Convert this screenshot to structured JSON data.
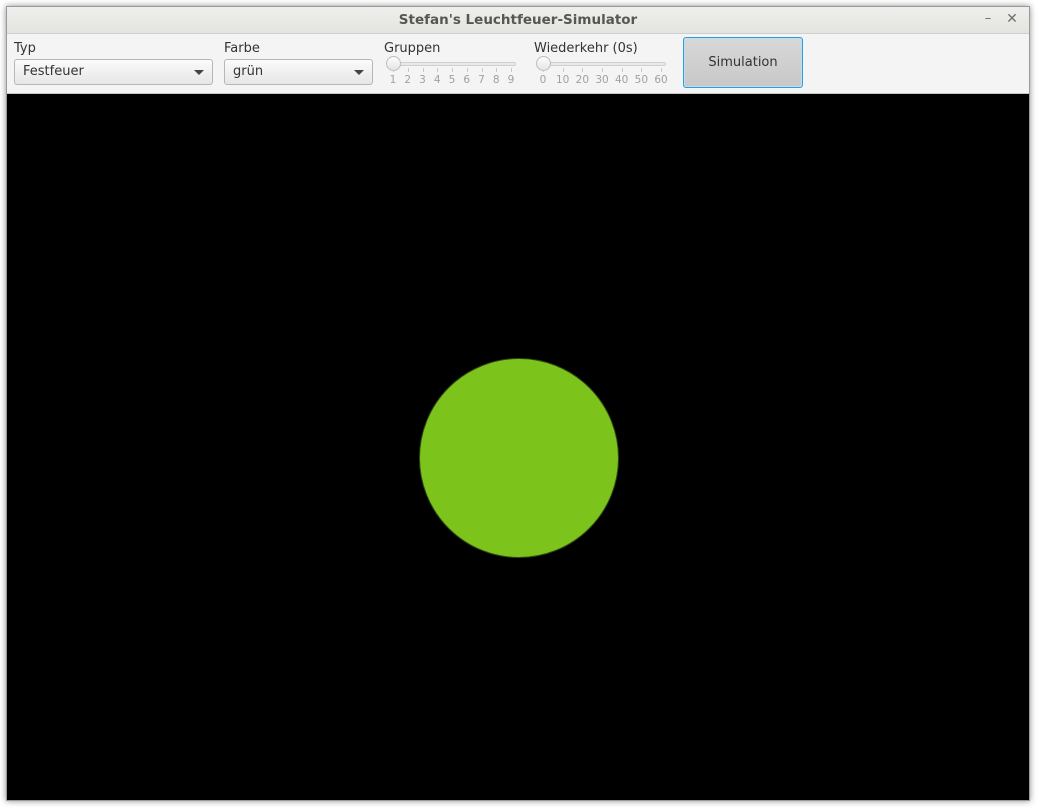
{
  "window": {
    "title": "Stefan's Leuchtfeuer-Simulator",
    "minimize_glyph": "–",
    "close_glyph": "✕"
  },
  "controls": {
    "typ": {
      "label": "Typ",
      "value": "Festfeuer"
    },
    "farbe": {
      "label": "Farbe",
      "value": "grün"
    },
    "gruppen": {
      "label": "Gruppen",
      "ticks": [
        "1",
        "2",
        "3",
        "4",
        "5",
        "6",
        "7",
        "8",
        "9"
      ],
      "value": 1
    },
    "wiederkehr": {
      "label": "Wiederkehr (0s)",
      "ticks": [
        "0",
        "10",
        "20",
        "30",
        "40",
        "50",
        "60"
      ],
      "value": 0
    },
    "simulation_button": "Simulation"
  },
  "display": {
    "background_color": "#000000",
    "light_color": "#7cc41b",
    "light_shape": "circle"
  }
}
